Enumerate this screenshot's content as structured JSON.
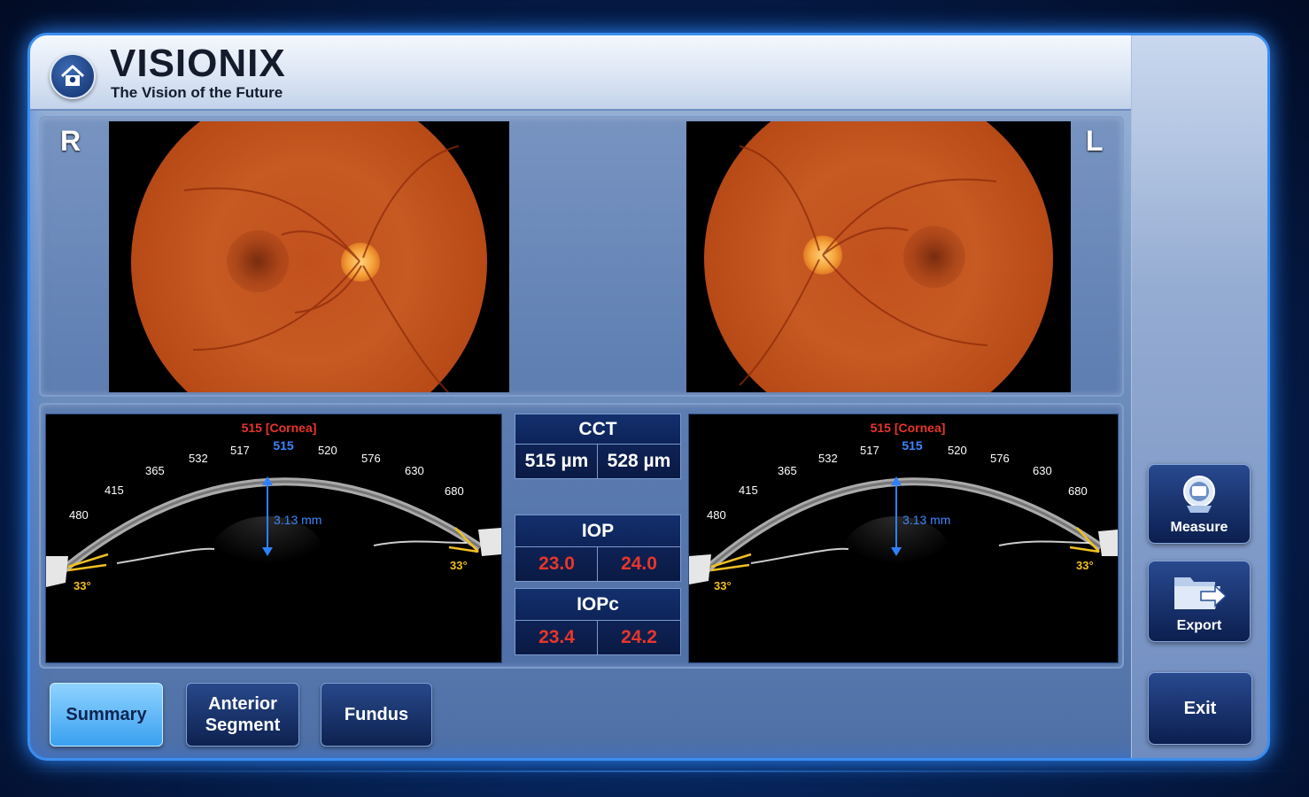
{
  "brand": {
    "title": "VISIONIX",
    "subtitle": "The Vision of the Future"
  },
  "fundus": {
    "right_label": "R",
    "left_label": "L"
  },
  "oct_right": {
    "cornea_label": "515 [Cornea]",
    "center_value": "515",
    "thickness": [
      "480",
      "415",
      "365",
      "532",
      "517",
      "520",
      "576",
      "630",
      "680"
    ],
    "depth": "3.13 mm",
    "angle_left": "33°",
    "angle_right": "33°"
  },
  "oct_left": {
    "cornea_label": "515 [Cornea]",
    "center_value": "515",
    "thickness": [
      "480",
      "415",
      "365",
      "532",
      "517",
      "520",
      "576",
      "630",
      "680"
    ],
    "depth": "3.13 mm",
    "angle_left": "33°",
    "angle_right": "33°"
  },
  "metrics": {
    "cct": {
      "label": "CCT",
      "right": "515 µm",
      "left": "528 µm"
    },
    "iop": {
      "label": "IOP",
      "right": "23.0",
      "left": "24.0"
    },
    "iopc": {
      "label": "IOPc",
      "right": "23.4",
      "left": "24.2"
    },
    "value_alert_color": "#e8362a"
  },
  "tabs": {
    "summary": "Summary",
    "anterior_1": "Anterior",
    "anterior_2": "Segment",
    "fundus": "Fundus"
  },
  "side_buttons": {
    "measure": "Measure",
    "export": "Export",
    "exit": "Exit"
  },
  "icons": [
    "home-icon",
    "measure-icon",
    "export-folder-icon"
  ]
}
